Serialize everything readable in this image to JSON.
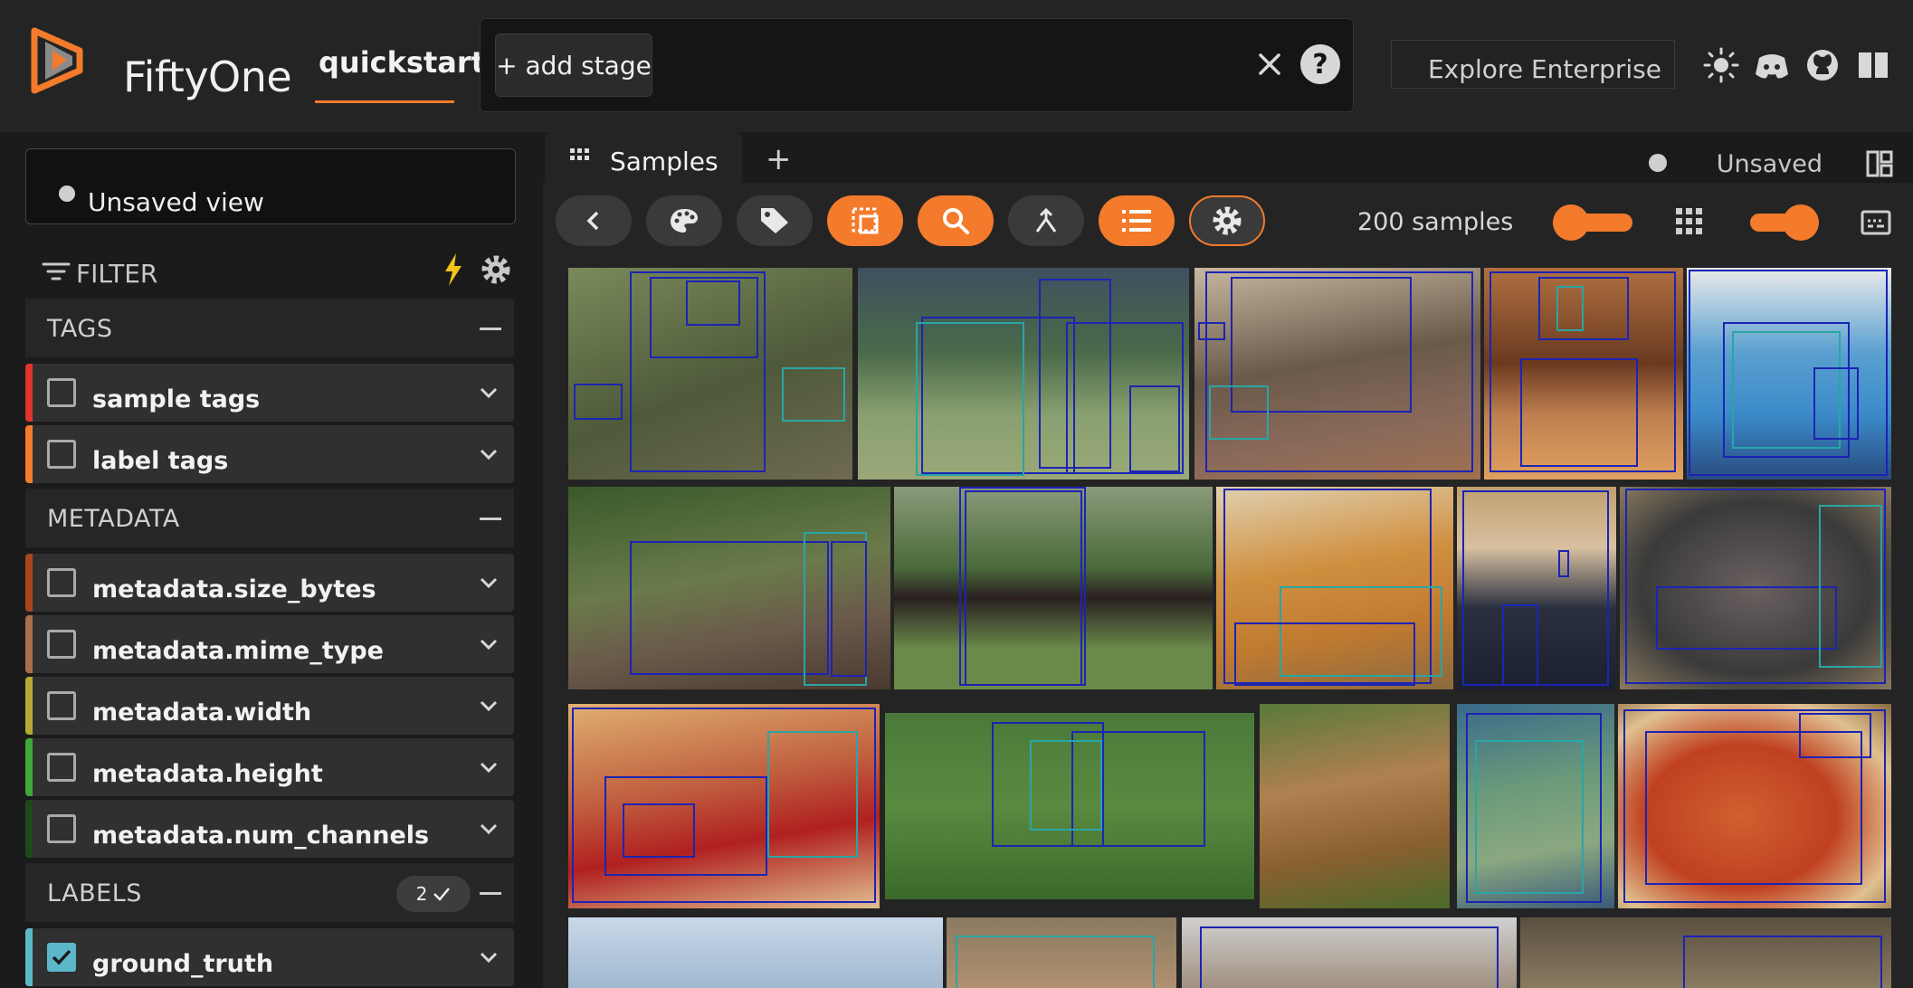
{
  "header": {
    "brand": "FiftyOne",
    "dataset": "quickstart",
    "add_stage_label": "+ add stage",
    "help_label": "?",
    "explore_label": "Explore Enterprise"
  },
  "sidebar": {
    "view_status": "Unsaved view",
    "filter_label": "FILTER",
    "sections": {
      "tags": "TAGS",
      "metadata": "METADATA",
      "labels": "LABELS"
    },
    "labels_badge": "2",
    "fields": [
      {
        "label": "sample tags",
        "color": "#e0352b",
        "checked": false
      },
      {
        "label": "label tags",
        "color": "#f37b2b",
        "checked": false
      },
      {
        "label": "metadata.size_bytes",
        "color": "#a9441f",
        "checked": false
      },
      {
        "label": "metadata.mime_type",
        "color": "#a86f4a",
        "checked": false
      },
      {
        "label": "metadata.width",
        "color": "#b7a833",
        "checked": false
      },
      {
        "label": "metadata.height",
        "color": "#3ea83a",
        "checked": false
      },
      {
        "label": "metadata.num_channels",
        "color": "#1d4a1d",
        "checked": false
      },
      {
        "label": "ground_truth",
        "color": "#5cb8c8",
        "checked": true
      }
    ]
  },
  "main": {
    "tab_label": "Samples",
    "tab_plus": "+",
    "save_status": "Unsaved",
    "sample_count": "200 samples"
  },
  "colors": {
    "accent": "#f37b2b",
    "box_blue": "#1c24b4",
    "box_teal": "#2aa5a5"
  }
}
